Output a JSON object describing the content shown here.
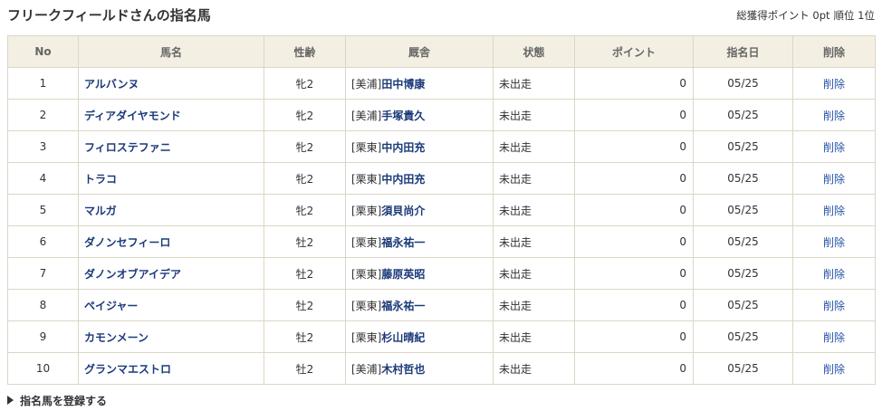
{
  "header": {
    "title": "フリークフィールドさんの指名馬",
    "total_points": "総獲得ポイント 0pt",
    "rank": "順位 1位"
  },
  "table": {
    "columns": {
      "no": "No",
      "name": "馬名",
      "sex_age": "性齢",
      "stable": "厩舎",
      "status": "状態",
      "point": "ポイント",
      "date": "指名日",
      "delete": "削除"
    },
    "rows": [
      {
        "no": "1",
        "name": "アルバンヌ",
        "sex_age": "牝2",
        "region": "[美浦]",
        "trainer": "田中博康",
        "status": "未出走",
        "point": "0",
        "date": "05/25",
        "delete": "削除"
      },
      {
        "no": "2",
        "name": "ディアダイヤモンド",
        "sex_age": "牝2",
        "region": "[美浦]",
        "trainer": "手塚貴久",
        "status": "未出走",
        "point": "0",
        "date": "05/25",
        "delete": "削除"
      },
      {
        "no": "3",
        "name": "フィロステファニ",
        "sex_age": "牝2",
        "region": "[栗東]",
        "trainer": "中内田充",
        "status": "未出走",
        "point": "0",
        "date": "05/25",
        "delete": "削除"
      },
      {
        "no": "4",
        "name": "トラコ",
        "sex_age": "牝2",
        "region": "[栗東]",
        "trainer": "中内田充",
        "status": "未出走",
        "point": "0",
        "date": "05/25",
        "delete": "削除"
      },
      {
        "no": "5",
        "name": "マルガ",
        "sex_age": "牝2",
        "region": "[栗東]",
        "trainer": "須貝尚介",
        "status": "未出走",
        "point": "0",
        "date": "05/25",
        "delete": "削除"
      },
      {
        "no": "6",
        "name": "ダノンセフィーロ",
        "sex_age": "牡2",
        "region": "[栗東]",
        "trainer": "福永祐一",
        "status": "未出走",
        "point": "0",
        "date": "05/25",
        "delete": "削除"
      },
      {
        "no": "7",
        "name": "ダノンオブアイデア",
        "sex_age": "牡2",
        "region": "[栗東]",
        "trainer": "藤原英昭",
        "status": "未出走",
        "point": "0",
        "date": "05/25",
        "delete": "削除"
      },
      {
        "no": "8",
        "name": "ペイジャー",
        "sex_age": "牡2",
        "region": "[栗東]",
        "trainer": "福永祐一",
        "status": "未出走",
        "point": "0",
        "date": "05/25",
        "delete": "削除"
      },
      {
        "no": "9",
        "name": "カモンメーン",
        "sex_age": "牡2",
        "region": "[栗東]",
        "trainer": "杉山晴紀",
        "status": "未出走",
        "point": "0",
        "date": "05/25",
        "delete": "削除"
      },
      {
        "no": "10",
        "name": "グランマエストロ",
        "sex_age": "牡2",
        "region": "[美浦]",
        "trainer": "木村哲也",
        "status": "未出走",
        "point": "0",
        "date": "05/25",
        "delete": "削除"
      }
    ]
  },
  "register": {
    "icon": "triangle-right-icon",
    "label": "指名馬を登録する"
  },
  "colors": {
    "header_bg": "#f3efe3",
    "border": "#dcd6c6",
    "link": "#1b3a7a",
    "delete_link": "#2553a6"
  }
}
